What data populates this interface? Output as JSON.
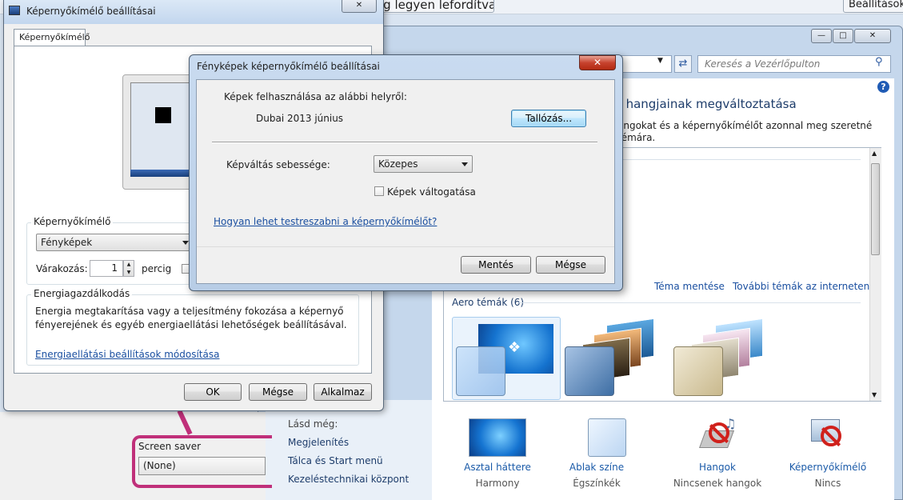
{
  "top_strip": {
    "partial_title": "ig legyen lefordítva",
    "partial_right": "Beállítások"
  },
  "control_panel": {
    "search_placeholder": "Keresés a Vezérlőpulton",
    "heading": "s hangjainak megváltoztatása",
    "desc_line1": "angokat és a képernyőkímélőt azonnal meg szeretné",
    "desc_line2": "témára.",
    "save_theme": "Téma mentése",
    "more_themes": "További témák az interneten",
    "aero_label": "Aero témák (6)",
    "see_also": {
      "title": "Lásd még:",
      "items": [
        "Megjelenítés",
        "Tálca és Start menü",
        "Kezeléstechnikai központ"
      ]
    },
    "bottom_items": [
      {
        "label": "Asztal háttere",
        "value": "Harmony"
      },
      {
        "label": "Ablak színe",
        "value": "Égszínkék"
      },
      {
        "label": "Hangok",
        "value": "Nincsenek hangok"
      },
      {
        "label": "Képernyőkímélő",
        "value": "Nincs"
      }
    ]
  },
  "screen_saver_snippet": {
    "label": "Screen saver",
    "value": "(None)"
  },
  "ss_settings": {
    "title": "Képernyőkímélő beállításai",
    "tab": "Képernyőkímélő",
    "group_ss": "Képernyőkímélő",
    "selected": "Fényképek",
    "wait_label": "Várakozás:",
    "wait_value": "1",
    "wait_unit": "percig",
    "group_energy": "Energiagazdálkodás",
    "energy_text1": "Energia megtakarítása vagy a teljesítmény fokozása a képernyő",
    "energy_text2": "fényerejének és egyéb energiaellátási lehetőségek beállításával.",
    "energy_link": "Energiaellátási beállítások módosítása",
    "ok": "OK",
    "cancel": "Mégse",
    "apply": "Alkalmaz"
  },
  "photo_settings": {
    "title": "Fényképek képernyőkímélő beállításai",
    "use_from": "Képek felhasználása az alábbi helyről:",
    "folder": "Dubai 2013 június",
    "browse": "Tallózás...",
    "speed_label": "Képváltás sebessége:",
    "speed_value": "Közepes",
    "shuffle": "Képek váltogatása",
    "help_link": "Hogyan lehet testreszabni a képernyőkímélőt?",
    "save": "Mentés",
    "cancel": "Mégse"
  }
}
